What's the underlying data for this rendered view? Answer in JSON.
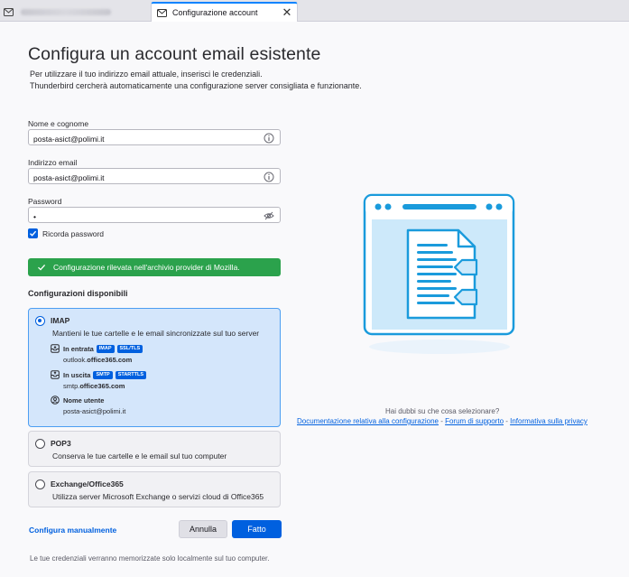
{
  "tabs": {
    "inactive_icon": "mail-icon",
    "active": {
      "label": "Configurazione account",
      "icon": "mail-icon"
    }
  },
  "page": {
    "title": "Configura un account email esistente",
    "intro_line1": "Per utilizzare il tuo indirizzo email attuale, inserisci le credenziali.",
    "intro_line2": "Thunderbird cercherà automaticamente una configurazione server consigliata e funzionante."
  },
  "form": {
    "name_label": "Nome e cognome",
    "name_value": "posta-asict@polimi.it",
    "email_label": "Indirizzo email",
    "email_value": "posta-asict@polimi.it",
    "password_label": "Password",
    "password_value": "•",
    "remember_label": "Ricorda password",
    "remember_checked": true
  },
  "notice": {
    "text": "Configurazione rilevata nell'archivio provider di Mozilla."
  },
  "configs": {
    "title": "Configurazioni disponibili",
    "imap": {
      "title": "IMAP",
      "desc": "Mantieni le tue cartelle e le email sincronizzate sul tuo server",
      "incoming_label": "In entrata",
      "incoming_badges": [
        "IMAP",
        "SSL/TLS"
      ],
      "incoming_host_prefix": "outlook.",
      "incoming_host_bold": "office365.com",
      "outgoing_label": "In uscita",
      "outgoing_badges": [
        "SMTP",
        "STARTTLS"
      ],
      "outgoing_host_prefix": "smtp.",
      "outgoing_host_bold": "office365.com",
      "username_label": "Nome utente",
      "username_value": "posta-asict@polimi.it"
    },
    "pop3": {
      "title": "POP3",
      "desc": "Conserva le tue cartelle e le email sul tuo computer"
    },
    "exchange": {
      "title": "Exchange/Office365",
      "desc": "Utilizza server Microsoft Exchange o servizi cloud di Office365"
    }
  },
  "actions": {
    "manual": "Configura manualmente",
    "cancel": "Annulla",
    "done": "Fatto"
  },
  "footer": "Le tue credenziali verranno memorizzate solo localmente sul tuo computer.",
  "help": {
    "question": "Hai dubbi su che cosa selezionare?",
    "link_docs": "Documentazione relativa alla configurazione",
    "sep": " - ",
    "link_support": "Forum di supporto",
    "link_privacy": "Informativa sulla privacy"
  },
  "colors": {
    "accent": "#0060df",
    "success": "#2ba24c",
    "selected_bg": "#d4e6fb"
  }
}
